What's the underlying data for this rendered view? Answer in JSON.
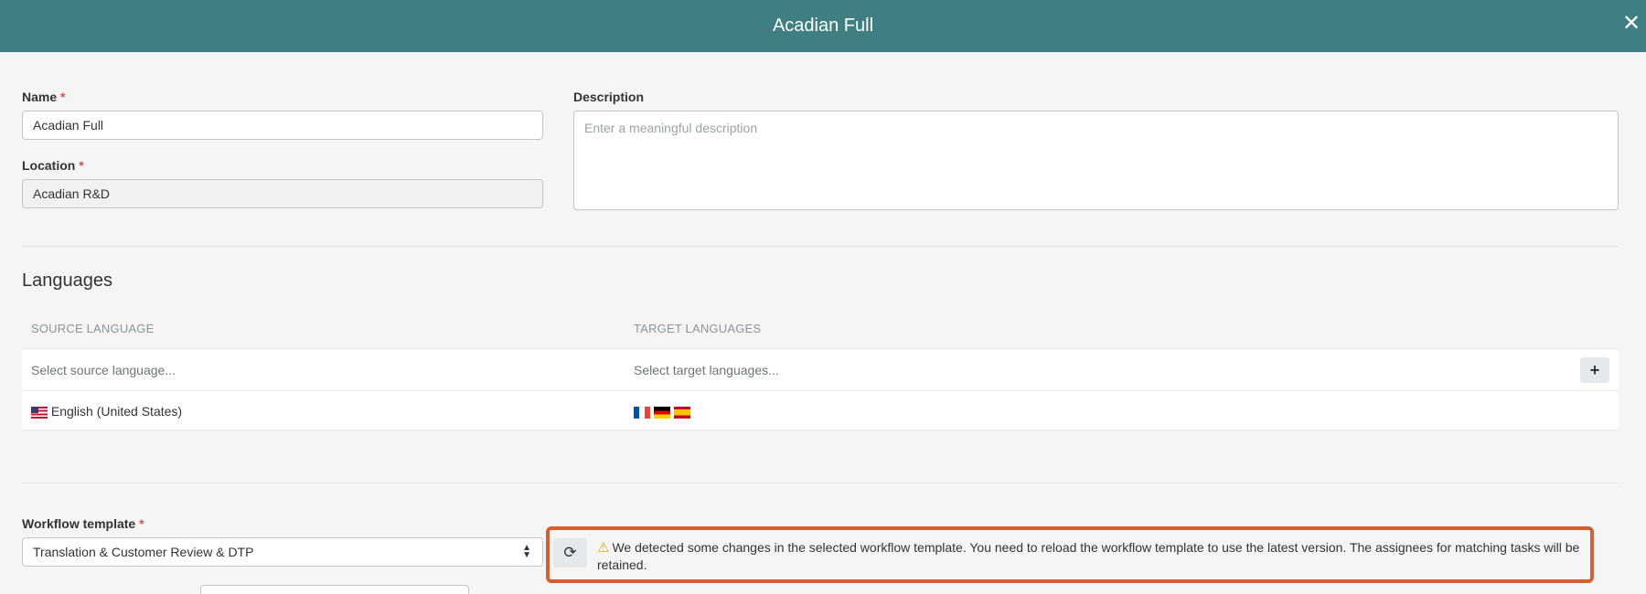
{
  "header": {
    "title": "Acadian Full",
    "close_icon": "close-icon"
  },
  "form": {
    "name_label": "Name",
    "name_value": "Acadian Full",
    "location_label": "Location",
    "location_value": "Acadian R&D",
    "description_label": "Description",
    "description_placeholder": "Enter a meaningful description",
    "required_marker": "*"
  },
  "languages": {
    "title": "Languages",
    "source_header": "SOURCE LANGUAGE",
    "target_header": "TARGET LANGUAGES",
    "source_placeholder": "Select source language...",
    "target_placeholder": "Select target languages...",
    "add_label": "+",
    "row": {
      "source": "English (United States)",
      "source_flag": "us-flag-icon",
      "target_flags": [
        "fr-flag-icon",
        "de-flag-icon",
        "es-flag-icon"
      ]
    }
  },
  "workflow": {
    "label": "Workflow template",
    "selected": "Translation & Customer Review & DTP",
    "reload_icon": "refresh-icon",
    "warning_icon": "warning-icon",
    "warning_text": "We detected some changes in the selected workflow template. You need to reload the workflow template to use the latest version. The assignees for matching tasks will be retained.",
    "highlight_color": "#d35f33"
  },
  "colors": {
    "header_bg": "#3f7f81",
    "required": "#d9534f",
    "warning": "#e0a800"
  }
}
